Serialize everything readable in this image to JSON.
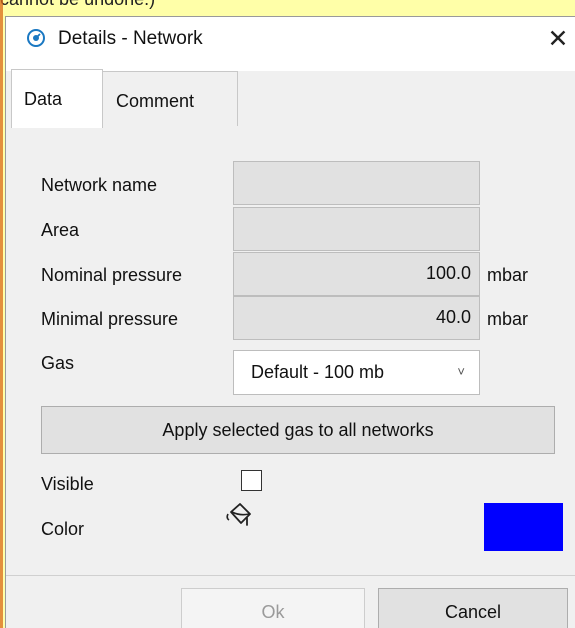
{
  "background": {
    "partial_text": "cannot be undone.)"
  },
  "window": {
    "title": "Details - Network",
    "close_glyph": "✕",
    "icon": "network-details-icon"
  },
  "tabs": [
    {
      "label": "Data",
      "active": true
    },
    {
      "label": "Comment",
      "active": false
    }
  ],
  "form": {
    "network_name": {
      "label": "Network name",
      "value": ""
    },
    "area": {
      "label": "Area",
      "value": ""
    },
    "nominal_pressure": {
      "label": "Nominal pressure",
      "value": "100.0",
      "unit": "mbar"
    },
    "minimal_pressure": {
      "label": "Minimal pressure",
      "value": "40.0",
      "unit": "mbar"
    },
    "gas": {
      "label": "Gas",
      "selected": "Default - 100 mb",
      "chevron": "˅"
    },
    "apply_button": "Apply selected gas to all networks",
    "visible": {
      "label": "Visible",
      "checked": false
    },
    "color": {
      "label": "Color",
      "value": "#0000ff",
      "icon": "paint-bucket-icon"
    }
  },
  "buttons": {
    "ok": "Ok",
    "cancel": "Cancel"
  },
  "colors": {
    "dialog_bg": "#f0f0f0",
    "field_bg": "#e1e1e1",
    "swatch": "#0000ff",
    "outer_bg": "#ffffa8"
  }
}
